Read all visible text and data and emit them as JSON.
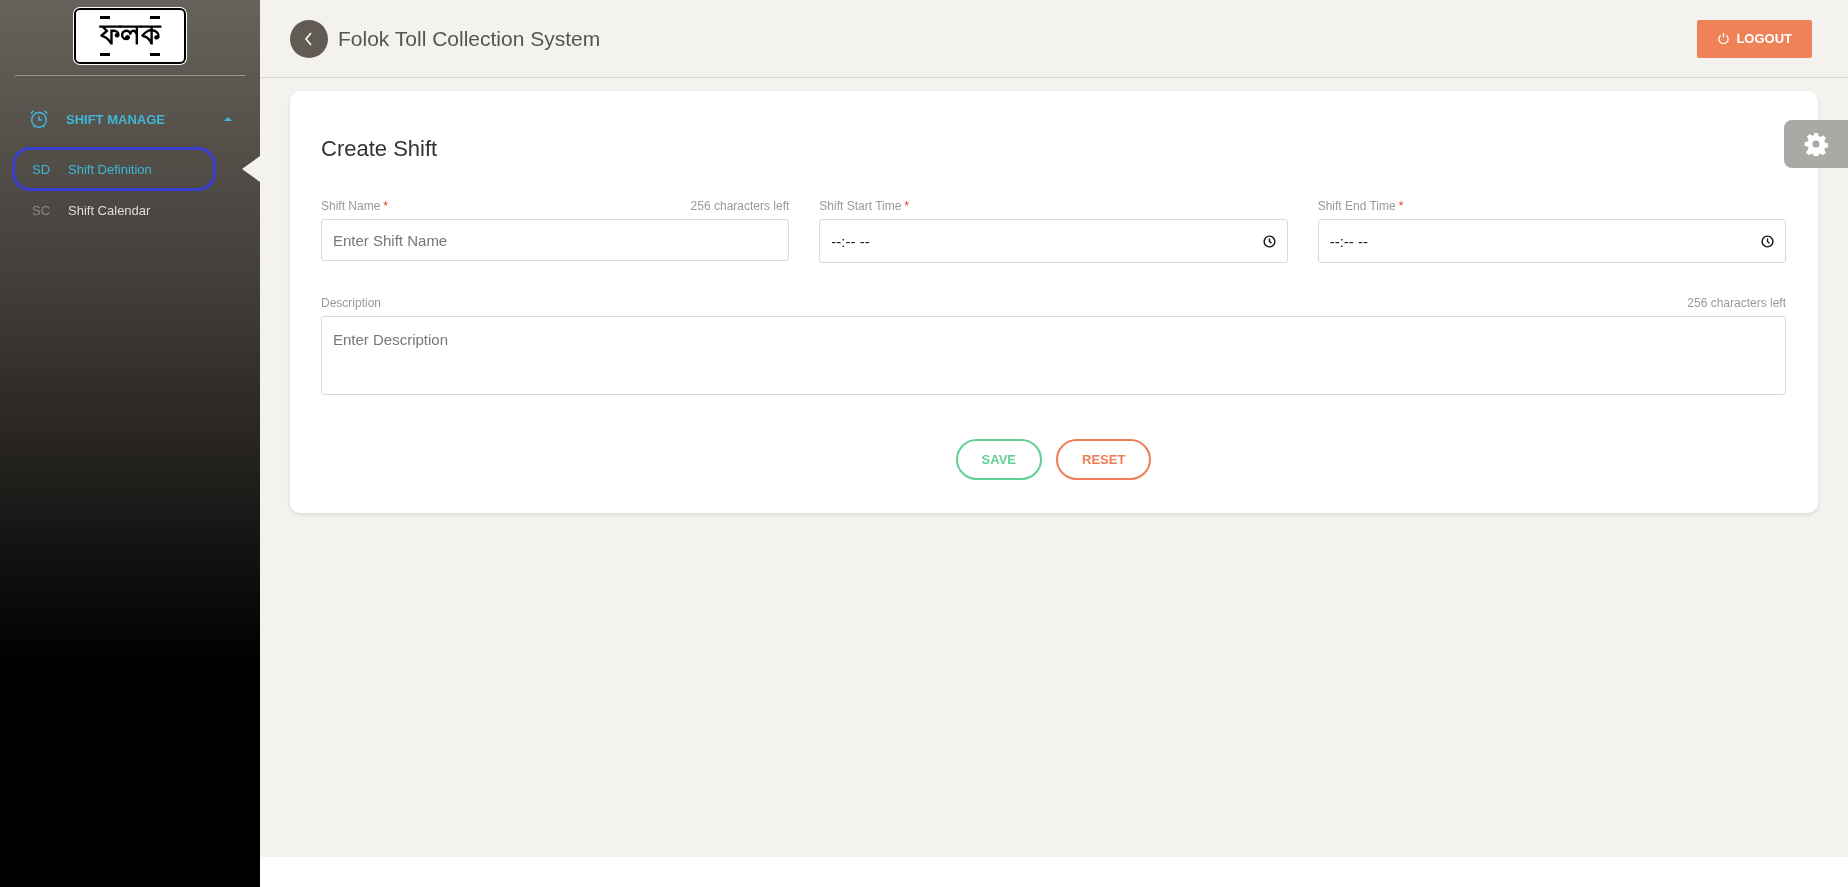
{
  "logo": {
    "text": "ফলক"
  },
  "sidebar": {
    "groups": [
      {
        "label": "SHIFT MANAGE",
        "expanded": true,
        "items": [
          {
            "abbr": "SD",
            "label": "Shift Definition",
            "selected": true
          },
          {
            "abbr": "SC",
            "label": "Shift Calendar",
            "selected": false
          }
        ]
      }
    ]
  },
  "header": {
    "title": "Folok Toll Collection System",
    "logout": "LOGOUT"
  },
  "form": {
    "title": "Create Shift",
    "fields": [
      {
        "kind": "text",
        "label": "Shift Name",
        "required_mark": "*",
        "counter": "256 characters left",
        "placeholder": "Enter Shift Name"
      },
      {
        "kind": "time",
        "label": "Shift Start Time",
        "required_mark": "*",
        "value": "--:-- --"
      },
      {
        "kind": "time",
        "label": "Shift End Time",
        "required_mark": "*",
        "value": "--:-- --"
      }
    ],
    "description": {
      "label": "Description",
      "counter": "256 characters left",
      "placeholder": "Enter Description"
    },
    "buttons": [
      {
        "kind": "save",
        "label": "SAVE"
      },
      {
        "kind": "reset",
        "label": "RESET"
      }
    ]
  }
}
